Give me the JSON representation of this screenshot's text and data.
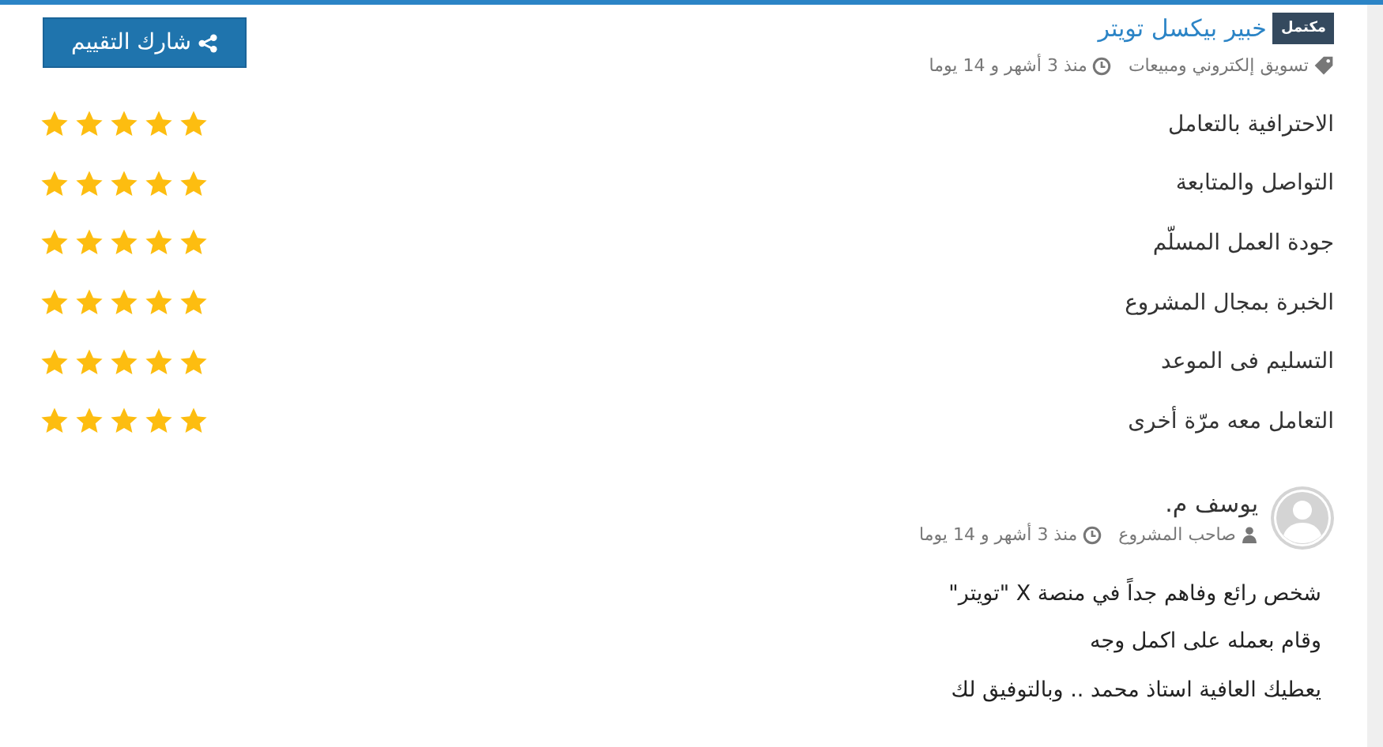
{
  "project": {
    "status": "مكتمل",
    "title": "خبير بيكسل تويتر",
    "category": "تسويق إلكتروني ومبيعات",
    "time": "منذ 3 أشهر و 14 يوما"
  },
  "share_button": {
    "label": "شارك التقييم"
  },
  "ratings": [
    {
      "label": "الاحترافية بالتعامل",
      "stars": 5
    },
    {
      "label": "التواصل والمتابعة",
      "stars": 5
    },
    {
      "label": "جودة العمل المسلّم",
      "stars": 5
    },
    {
      "label": "الخبرة بمجال المشروع",
      "stars": 5
    },
    {
      "label": "التسليم فى الموعد",
      "stars": 5
    },
    {
      "label": "التعامل معه مرّة أخرى",
      "stars": 5
    }
  ],
  "review": {
    "name": "يوسف م.",
    "role": "صاحب المشروع",
    "time": "منذ 3 أشهر و 14 يوما",
    "lines": [
      "شخص رائع وفاهم جداً في منصة X \"تويتر\"",
      "وقام بعمله على اكمل وجه",
      "يعطيك العافية استاذ محمد .. وبالتوفيق لك"
    ]
  }
}
